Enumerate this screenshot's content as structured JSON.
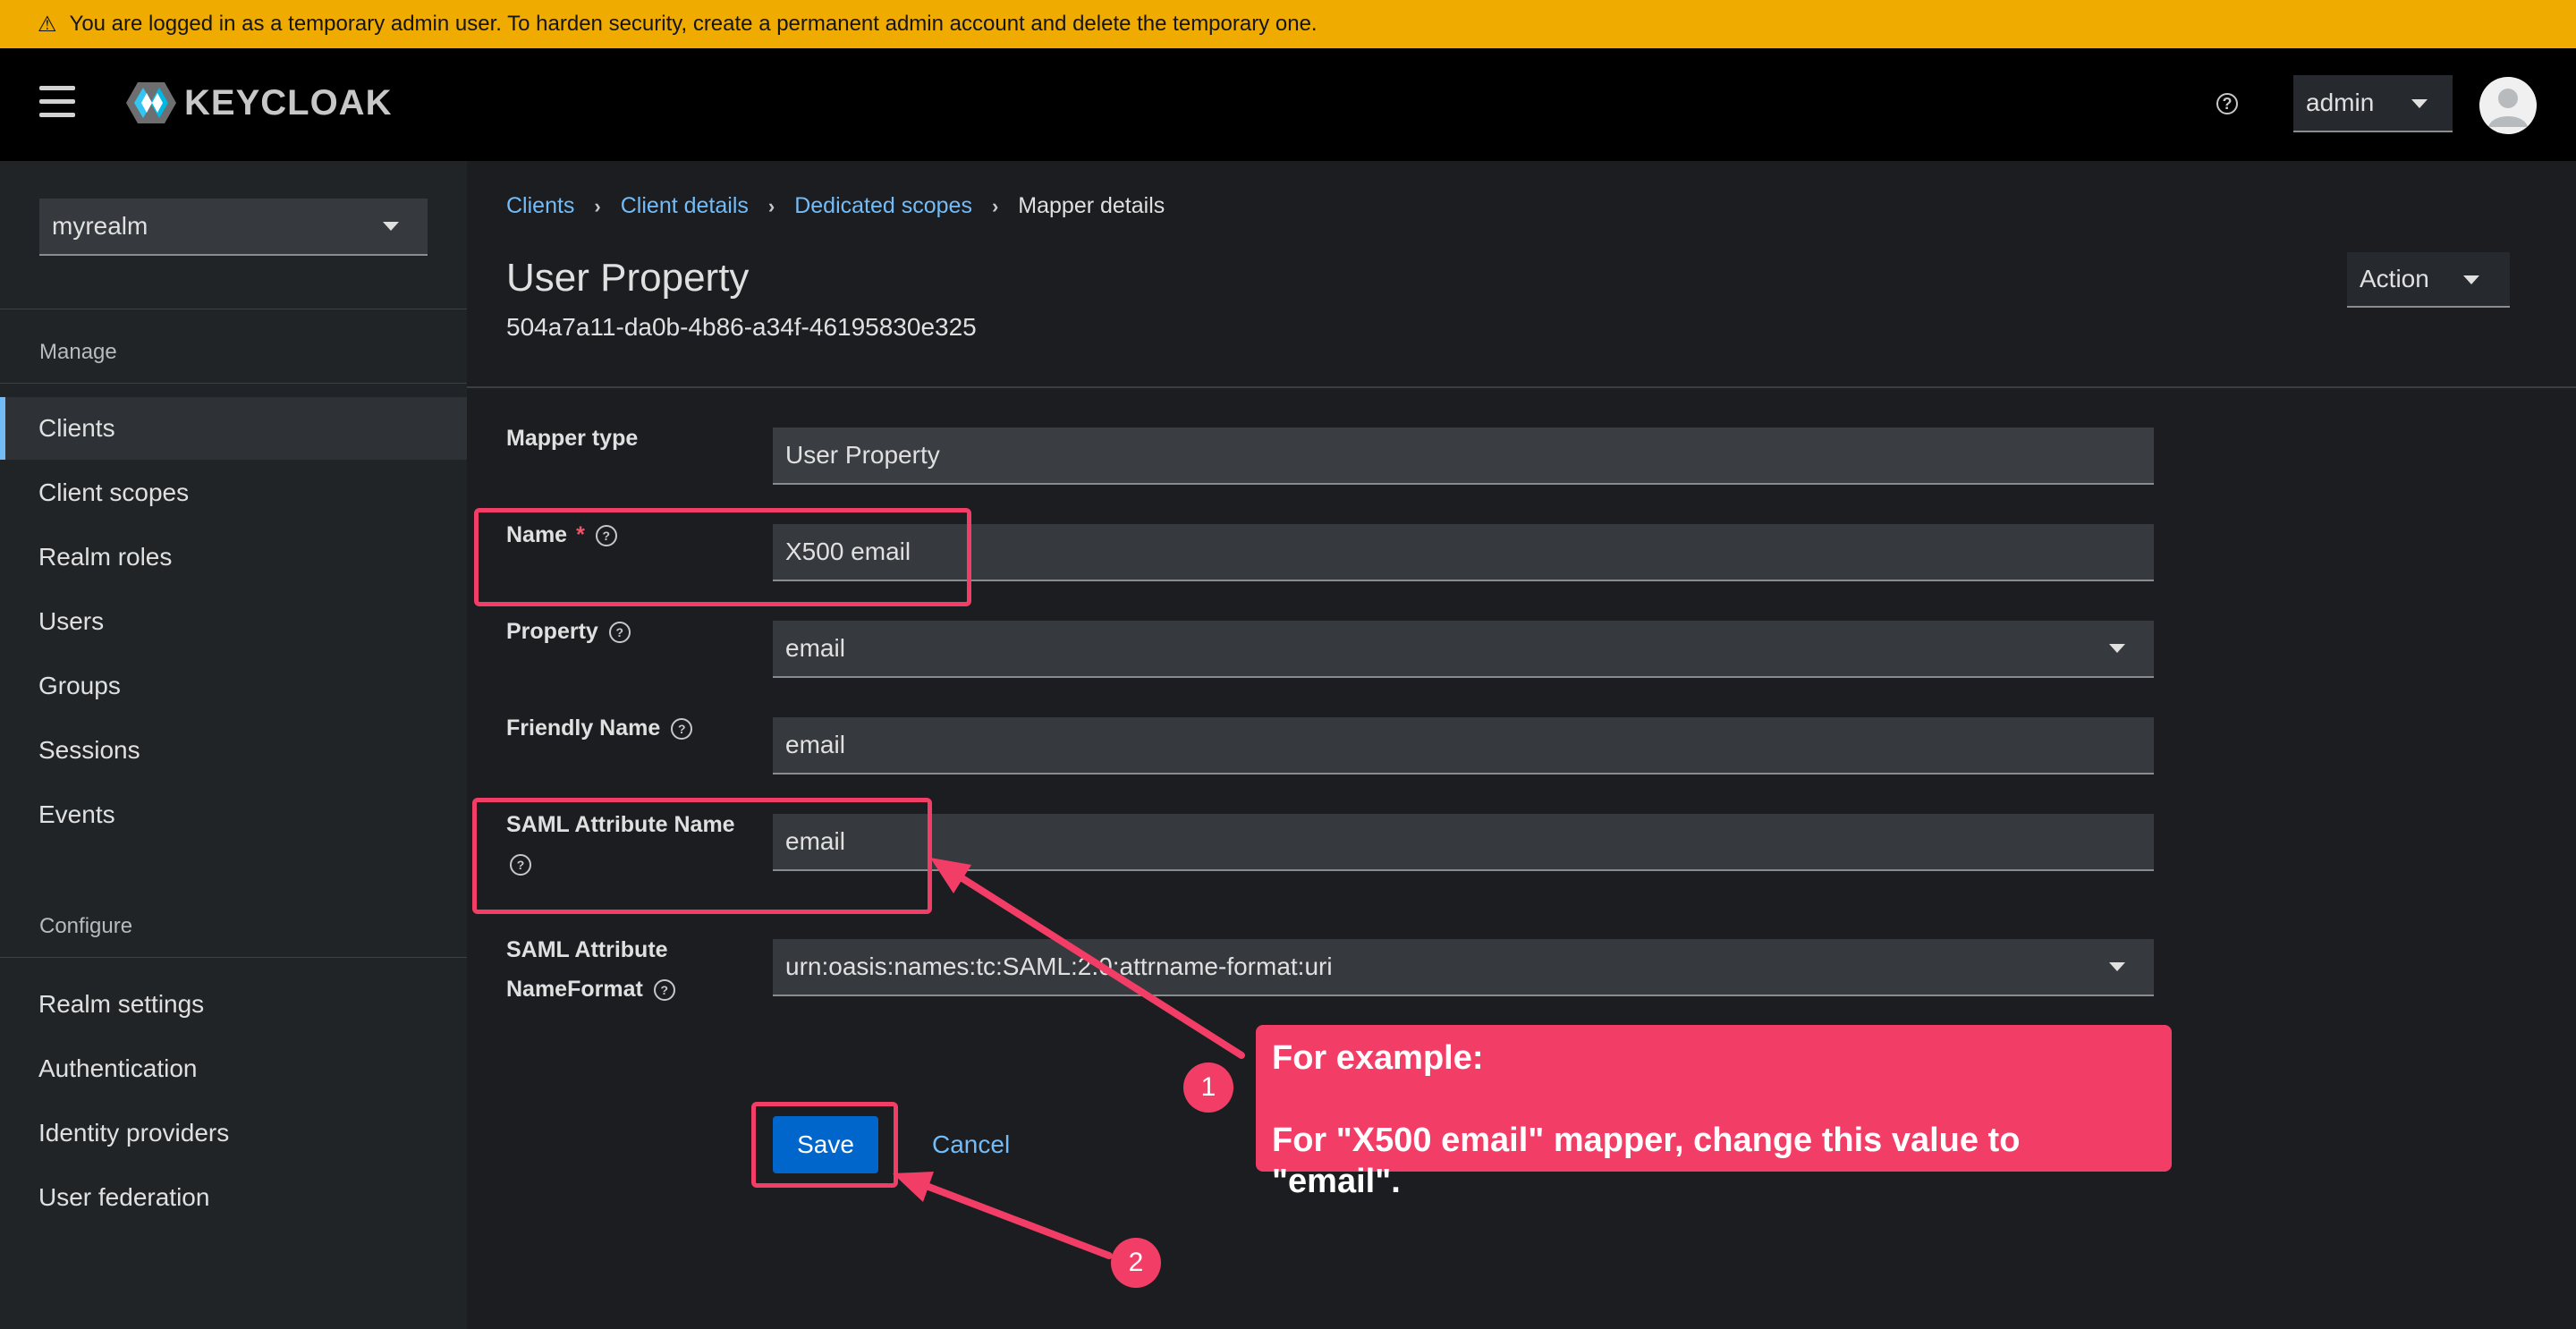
{
  "banner": {
    "text": "You are logged in as a temporary admin user. To harden security, create a permanent admin account and delete the temporary one."
  },
  "header": {
    "logo_text": "KEYCLOAK",
    "user": "admin"
  },
  "sidebar": {
    "realm": "myrealm",
    "manage_label": "Manage",
    "manage_items": [
      "Clients",
      "Client scopes",
      "Realm roles",
      "Users",
      "Groups",
      "Sessions",
      "Events"
    ],
    "configure_label": "Configure",
    "configure_items": [
      "Realm settings",
      "Authentication",
      "Identity providers",
      "User federation"
    ]
  },
  "breadcrumb": {
    "items": [
      "Clients",
      "Client details",
      "Dedicated scopes"
    ],
    "current": "Mapper details"
  },
  "page": {
    "title": "User Property",
    "id": "504a7a11-da0b-4b86-a34f-46195830e325",
    "action_label": "Action"
  },
  "form": {
    "mapper_type_label": "Mapper type",
    "mapper_type_value": "User Property",
    "name_label": "Name",
    "name_required": "*",
    "name_value": "X500 email",
    "property_label": "Property",
    "property_value": "email",
    "friendly_name_label": "Friendly Name",
    "friendly_name_value": "email",
    "saml_attr_name_label": "SAML Attribute Name",
    "saml_attr_name_value": "email",
    "saml_nameformat_label_1": "SAML Attribute",
    "saml_nameformat_label_2": "NameFormat",
    "saml_nameformat_value": "urn:oasis:names:tc:SAML:2.0:attrname-format:uri",
    "save_label": "Save",
    "cancel_label": "Cancel"
  },
  "annotation": {
    "callout_line1": "For example:",
    "callout_line2": "For \"X500 email\" mapper, change this value to \"email\".",
    "badge_1": "1",
    "badge_2": "2",
    "color": "#f23d66"
  },
  "colors": {
    "banner": "#f0ab00",
    "link": "#73bcf7",
    "primary": "#0066cc"
  }
}
